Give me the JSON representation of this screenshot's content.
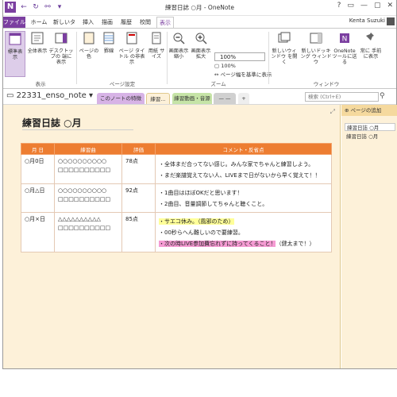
{
  "window": {
    "title": "練習日誌 ○月 - OneNote",
    "controls": [
      "?",
      "▭",
      "—",
      "▢",
      "✕"
    ],
    "qat": [
      "←",
      "↻",
      "⚯",
      "▾"
    ]
  },
  "tabs": [
    "ファイル",
    "ホーム",
    "新しいタブ",
    "挿入",
    "描画",
    "履歴",
    "校閲",
    "表示"
  ],
  "user": "Kenta Suzuki",
  "ribbon": {
    "buttons": [
      {
        "label": "標準表示"
      },
      {
        "label": "全体表示"
      },
      {
        "label": "デスクトップの 端に表示"
      },
      {
        "label": "ページの色"
      },
      {
        "label": "罫線"
      },
      {
        "label": "ページ タイトル の非表示"
      },
      {
        "label": "用紙 サイズ"
      },
      {
        "label": "画面表示 縮小"
      },
      {
        "label": "画面表示 拡大"
      },
      {
        "label": "新しいウィンドウ を開く"
      },
      {
        "label": "新しいドッキング ウィンドウ"
      },
      {
        "label": "OneNote ツールに送る"
      },
      {
        "label": "常に 手前に表示"
      }
    ],
    "zoom_value": "100%",
    "zoom_100": "100%",
    "page_width": "ページ幅を基準に表示",
    "groups": [
      "表示",
      "ページ設定",
      "ズーム",
      "ウィンドウ"
    ]
  },
  "notebook": {
    "name": "22331_enso_note",
    "sections": [
      "このノートの特徴",
      "練習...",
      "練習動画・音源",
      "— —",
      "+"
    ],
    "search_placeholder": "検索 (Ctrl+E)"
  },
  "page": {
    "title": "練習日誌 ○月",
    "table": {
      "headers": [
        "月 日",
        "練習曲",
        "評価",
        "コメント・反省点"
      ],
      "rows": [
        {
          "date": "○月0日",
          "songs": [
            "○○○○○○○○○○",
            "□□□□□□□□□□"
          ],
          "score": "78点",
          "comments": [
            "・全体まだ合ってない感じ。みんな家でちゃんと練習しよう。",
            "・まだ楽譜覚えてない人、LIVEまで日がないから早く覚えて！！"
          ]
        },
        {
          "date": "○月△日",
          "songs": [
            "○○○○○○○○○○",
            "□□□□□□□□□□"
          ],
          "score": "92点",
          "comments": [
            "・1曲目はほぼOKだと思います！",
            "・2曲目、音量調節してちゃんと聴くこと。"
          ]
        },
        {
          "date": "○月×日",
          "songs": [
            "△△△△△△△△△△",
            "□□□□□□□□□□"
          ],
          "score": "85点",
          "comments": [
            "・サエコ休み。（風邪のため）",
            "・00秒らへん難しいので要練習。",
            "・次の時LIVE参加費忘れずに持ってくること！",
            "（健太まで！）"
          ]
        }
      ]
    }
  },
  "pagelist": {
    "add": "ページの追加",
    "items": [
      "練習日誌 ○月",
      "練習日誌 ○月"
    ]
  }
}
